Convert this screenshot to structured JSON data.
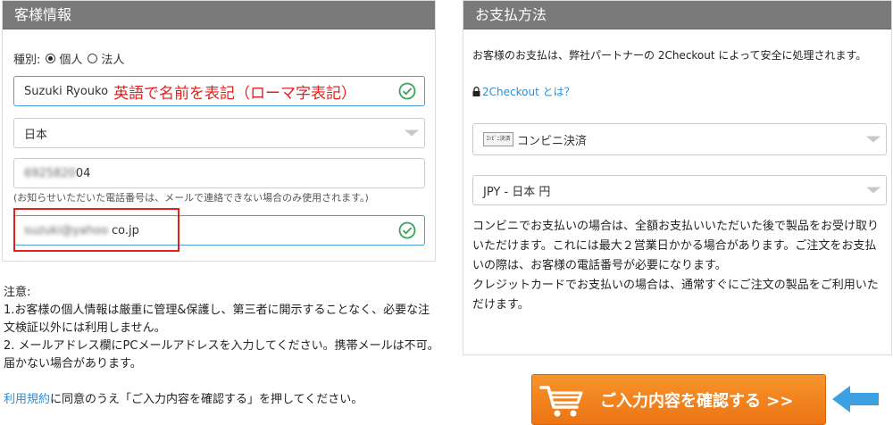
{
  "customer": {
    "title": "客様情報",
    "type_label": "種別:",
    "type_options": [
      "個人",
      "法人"
    ],
    "type_selected": "個人",
    "name_value": "Suzuki Ryouko",
    "name_note": "英語で名前を表記（ローマ字表記）",
    "country_value": "日本",
    "phone_blurred": "6925820",
    "phone_visible": "04",
    "phone_note": "(お知らせいただいた電話番号は、メールで連絡できない場合のみ使用されます。)",
    "email_blurred": "suzuki@yahoo",
    "email_visible": "co.jp"
  },
  "notice": {
    "heading": "注意:",
    "line1": "1.お客様の個人情報は厳重に管理&保護し、第三者に開示することなく、必要な注文検証以外には利用しません。",
    "line2": "2. メールアドレス欄にPCメールアドレスを入力してください。携帯メールは不可。届かない場合があります。",
    "terms_link": "利用規約",
    "agree_text": "に同意のうえ「ご入力内容を確認する」を押してください。"
  },
  "payment": {
    "title": "お支払方法",
    "intro": "お客様のお支払は、弊社パートナーの 2Checkout によって安全に処理されます。",
    "what_link": "2Checkout とは？",
    "method_badge": "ｺﾝﾋﾞﾆ決済",
    "method_value": "コンビニ決済",
    "currency_value": "JPY - 日本 円",
    "desc1": "コンビニでお支払いの場合は、全額お支払いいただいた後で製品をお受け取りいただけます。これには最大２営業日かかる場合があります。ご注文をお支払いの際は、お客様の電話番号が必要になります。",
    "desc2": "クレジットカードでお支払いの場合は、通常すぐにご注文の製品をご利用いただけます。"
  },
  "confirm_button": "ご入力内容を確認する >>",
  "icons": {
    "check": "check-circle-icon",
    "lock": "lock-icon",
    "cart": "cart-icon",
    "arrow": "arrow-left-icon"
  },
  "colors": {
    "header_bg": "#7a7a7a",
    "check_green": "#3aa35a",
    "accent_blue": "#2a8fd6",
    "button_orange": "#f0801b",
    "note_red": "#e3201b",
    "arrow_blue": "#3da0e0"
  }
}
